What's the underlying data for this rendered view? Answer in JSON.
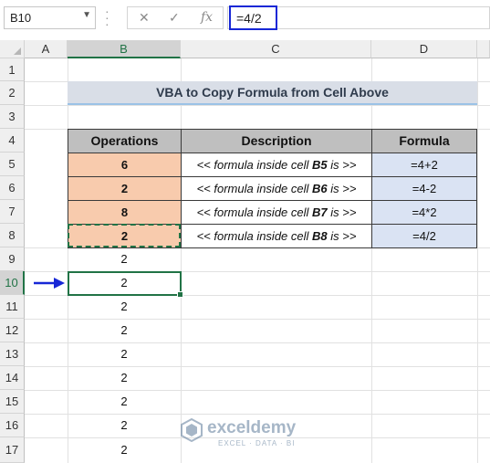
{
  "formula_bar": {
    "name_box": "B10",
    "cancel_icon": "✕",
    "enter_icon": "✓",
    "fx_label": "fx",
    "formula": "=4/2"
  },
  "columns": [
    "A",
    "B",
    "C",
    "D"
  ],
  "rows": [
    "1",
    "2",
    "3",
    "4",
    "5",
    "6",
    "7",
    "8",
    "9",
    "10",
    "11",
    "12",
    "13",
    "14",
    "15",
    "16",
    "17"
  ],
  "selected_cell": "B10",
  "title": "VBA to Copy Formula from Cell Above",
  "table": {
    "headers": [
      "Operations",
      "Description",
      "Formula"
    ],
    "rows": [
      {
        "operation": "6",
        "desc_prefix": "<< formula inside cell ",
        "cell_ref": "B5",
        "desc_suffix": " is >>",
        "formula": "=4+2"
      },
      {
        "operation": "2",
        "desc_prefix": "<< formula inside cell ",
        "cell_ref": "B6",
        "desc_suffix": " is >>",
        "formula": "=4-2"
      },
      {
        "operation": "8",
        "desc_prefix": "<< formula inside cell ",
        "cell_ref": "B7",
        "desc_suffix": " is >>",
        "formula": "=4*2"
      },
      {
        "operation": "2",
        "desc_prefix": "<< formula inside cell ",
        "cell_ref": "B8",
        "desc_suffix": " is >>",
        "formula": "=4/2"
      }
    ]
  },
  "copied_values": [
    "2",
    "2",
    "2",
    "2",
    "2",
    "2",
    "2",
    "2",
    "2"
  ],
  "watermark": {
    "name": "exceldemy",
    "tagline": "EXCEL · DATA · BI"
  },
  "colors": {
    "accent": "#217346",
    "arrow": "#1727d6",
    "op_fill": "#f8cbad",
    "formula_fill": "#dae3f3",
    "header_fill": "#bfbfbf"
  }
}
